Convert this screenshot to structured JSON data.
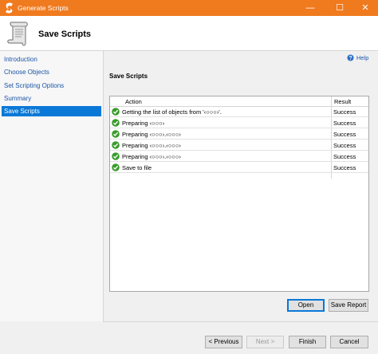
{
  "window": {
    "title": "Generate Scripts",
    "min_glyph": "—",
    "max_glyph": "☐",
    "close_glyph": "✕"
  },
  "header": {
    "title": "Save Scripts"
  },
  "sidebar": {
    "items": [
      {
        "label": "Introduction"
      },
      {
        "label": "Choose Objects"
      },
      {
        "label": "Set Scripting Options"
      },
      {
        "label": "Summary"
      },
      {
        "label": "Save Scripts"
      }
    ]
  },
  "help": {
    "label": "Help"
  },
  "main": {
    "section_title": "Save Scripts",
    "columns": {
      "action": "Action",
      "result": "Result"
    },
    "rows": [
      {
        "action": "Getting the list of objects from '‹○○○›'.",
        "result": "Success"
      },
      {
        "action": "Preparing ‹○○○›",
        "result": "Success"
      },
      {
        "action": "Preparing ‹○○○›.‹○○○›",
        "result": "Success"
      },
      {
        "action": "Preparing ‹○○○›.‹○○○›",
        "result": "Success"
      },
      {
        "action": "Preparing ‹○○○›.‹○○○›",
        "result": "Success"
      },
      {
        "action": "Save to file",
        "result": "Success"
      }
    ],
    "open_label": "Open",
    "save_report_label": "Save Report"
  },
  "footer": {
    "previous_label": "< Previous",
    "next_label": "Next >",
    "finish_label": "Finish",
    "cancel_label": "Cancel"
  },
  "colors": {
    "titlebar": "#f07a1e",
    "accent": "#0a78d7",
    "success": "#3a9b2c"
  }
}
